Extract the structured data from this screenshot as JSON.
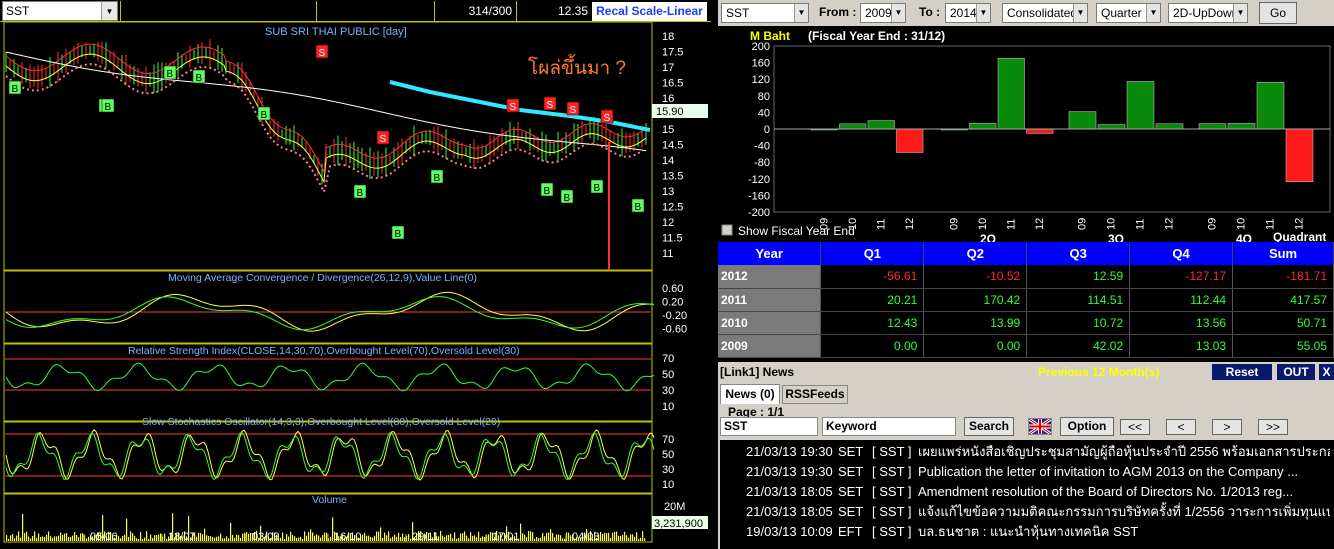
{
  "chart_panel": {
    "symbol": "SST",
    "counter": "314/300",
    "last_price": "12.35",
    "recal_label": "Recal Scale-Linear",
    "price_title": "SUB SRI THAI PUBLIC [day]",
    "annotation": "โผล่ขึ้นมา ?",
    "price_axis": [
      "18",
      "17.5",
      "17",
      "16.5",
      "16",
      "15.5",
      "15",
      "14.5",
      "14",
      "13.5",
      "13",
      "12.5",
      "12",
      "11.5",
      "11"
    ],
    "price_tag": "15.90",
    "macd_title": "Moving Average Convergence / Divergence(26,12,9),Value Line(0)",
    "macd_axis": [
      "0.60",
      "0.20",
      "-0.20",
      "-0.60"
    ],
    "rsi_title": "Relative Strength Index(CLOSE,14,30,70),Overbought Level(70),Oversold Level(30)",
    "rsi_axis": [
      "70",
      "50",
      "30",
      "10"
    ],
    "stoch_title": "Slow Stochastics Oscillator(14,3,3),Overbought Level(80),Oversold Level(20)",
    "stoch_axis": [
      "70",
      "50",
      "30",
      "10"
    ],
    "volume_title": "Volume",
    "volume_axis": "20M",
    "volume_tag": "3,231,900",
    "date_labels": [
      "05/06",
      "18/07",
      "03/09",
      "16/10",
      "29/11",
      "17/01",
      "04/03"
    ],
    "signals": [
      "B",
      "B",
      "B",
      "B",
      "B",
      "B",
      "B",
      "B",
      "B",
      "B",
      "B",
      "B",
      "B",
      "S",
      "S",
      "S",
      "S",
      "S",
      "S"
    ]
  },
  "fundamental": {
    "symbol": "SST",
    "from_label": "From :",
    "from_year": "2009",
    "to_label": "To :",
    "to_year": "2014",
    "mode": "Consolidated",
    "period": "Quarter",
    "view": "2D-UpDown",
    "go_label": "Go",
    "unit_label": "M Baht",
    "fiscal_label": "(Fiscal Year End : 31/12)",
    "show_fiscal_label": "Show Fiscal Year End",
    "quadrant_label": "Quadrant",
    "quarter_groups": [
      "2Q",
      "3Q",
      "4Q"
    ],
    "table": {
      "headers": [
        "Year",
        "Q1",
        "Q2",
        "Q3",
        "Q4",
        "Sum"
      ],
      "rows": [
        {
          "year": "2012",
          "values": [
            "-56.61",
            "-10.52",
            "12.59",
            "-127.17",
            "-181.71"
          ]
        },
        {
          "year": "2011",
          "values": [
            "20.21",
            "170.42",
            "114.51",
            "112.44",
            "417.57"
          ]
        },
        {
          "year": "2010",
          "values": [
            "12.43",
            "13.99",
            "10.72",
            "13.56",
            "50.71"
          ]
        },
        {
          "year": "2009",
          "values": [
            "0.00",
            "0.00",
            "42.02",
            "13.03",
            "55.05"
          ]
        }
      ]
    }
  },
  "chart_data": {
    "type": "bar",
    "ylabel": "M Baht",
    "ylim": [
      -200,
      200
    ],
    "yticks": [
      "200",
      "160",
      "120",
      "80",
      "40",
      "0",
      "-40",
      "-80",
      "-120",
      "-160",
      "-200"
    ],
    "categories": [
      "09",
      "10",
      "11",
      "12",
      "09",
      "10",
      "11",
      "12",
      "09",
      "10",
      "11",
      "12",
      "09",
      "10",
      "11",
      "12"
    ],
    "series": [
      {
        "name": "Q1",
        "values": [
          0.0,
          12.43,
          20.21,
          -56.61
        ]
      },
      {
        "name": "Q2",
        "values": [
          0.0,
          13.99,
          170.42,
          -10.52
        ]
      },
      {
        "name": "Q3",
        "values": [
          42.02,
          10.72,
          114.51,
          12.59
        ]
      },
      {
        "name": "Q4",
        "values": [
          13.03,
          13.56,
          112.44,
          -127.17
        ]
      }
    ]
  },
  "news": {
    "title": "[Link1] News",
    "period_label": "Previous 12 Month(s)",
    "reset_label": "Reset",
    "out_label": "OUT",
    "close_label": "X",
    "tab_news": "News (0)",
    "tab_rss": "RSSFeeds",
    "page_label": "Page : 1/1",
    "symbol_value": "SST",
    "keyword_value": "Keyword",
    "search_label": "Search",
    "option_label": "Option",
    "nav_first": "<<",
    "nav_prev": "<",
    "nav_next": ">",
    "nav_last": ">>",
    "items": [
      {
        "date": "21/03/13 19:30",
        "market": "SET",
        "symbol": "[ SST ]",
        "headline": "เผยแพร่หนังสือเชิญประชุมสามัญผู้ถือหุ้นประจำปี 2556 พร้อมเอกสารประกอบการ..."
      },
      {
        "date": "21/03/13 19:30",
        "market": "SET",
        "symbol": "[ SST ]",
        "headline": "Publication the letter of invitation to AGM 2013 on the Company ..."
      },
      {
        "date": "21/03/13 18:05",
        "market": "SET",
        "symbol": "[ SST ]",
        "headline": "Amendment resolution of the Board of Directors No. 1/2013 reg..."
      },
      {
        "date": "21/03/13 18:05",
        "market": "SET",
        "symbol": "[ SST ]",
        "headline": "แจ้งแก้ไขข้อความมติคณะกรรมการบริษัทครั้งที่ 1/2556 วาระการเพิ่มทุนแบบ Ge..."
      },
      {
        "date": "19/03/13 10:09",
        "market": "EFT",
        "symbol": "[ SST ]",
        "headline": "บล.ธนชาต : แนะนำหุ้นทางเทคนิค SST"
      }
    ]
  },
  "colors": {
    "up": "#0a8a0a",
    "down": "#ff1a1a",
    "header_blue": "#0000ff",
    "grid_yellow": "#c0c000"
  }
}
